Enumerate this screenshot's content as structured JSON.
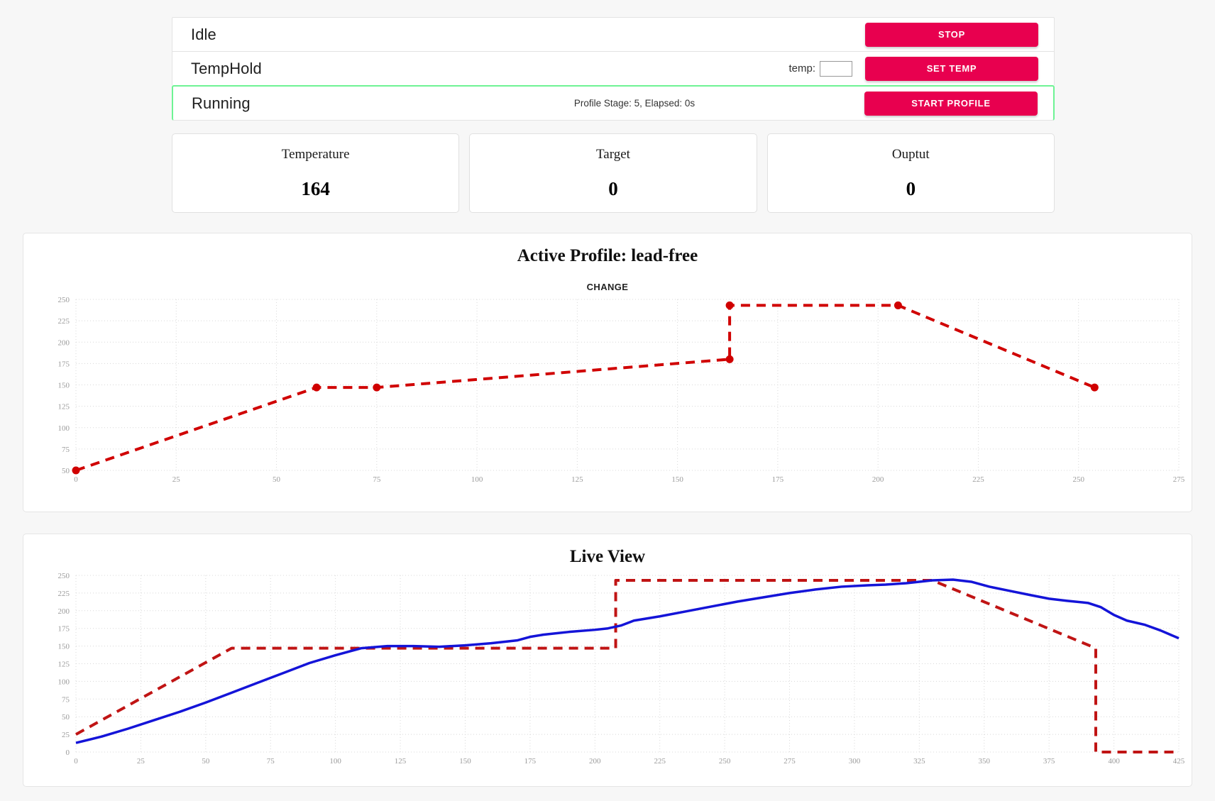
{
  "controls": {
    "rows": [
      {
        "label": "Idle",
        "middle": "",
        "button": "STOP"
      },
      {
        "label": "TempHold",
        "middle": "",
        "button": "SET TEMP",
        "temp_label": "temp:",
        "temp_value": "",
        "temp_placeholder": ""
      },
      {
        "label": "Running",
        "middle": "Profile Stage: 5, Elapsed: 0s",
        "button": "START PROFILE"
      }
    ],
    "active_row_index": 2,
    "accent_button_color": "#e8004f",
    "active_border_color": "#6ef394"
  },
  "cards": [
    {
      "title": "Temperature",
      "value": "164"
    },
    {
      "title": "Target",
      "value": "0"
    },
    {
      "title": "Ouptut",
      "value": "0"
    }
  ],
  "profile_panel": {
    "title": "Active Profile: lead-free",
    "sublabel": "CHANGE"
  },
  "live_panel": {
    "title": "Live View"
  },
  "chart_data": [
    {
      "id": "active-profile",
      "type": "line",
      "title": "Active Profile: lead-free",
      "subtitle": "CHANGE",
      "xlabel": "",
      "ylabel": "",
      "xlim": [
        0,
        275
      ],
      "ylim": [
        50,
        250
      ],
      "xticks": [
        0,
        25,
        50,
        75,
        100,
        125,
        150,
        175,
        200,
        225,
        250,
        275
      ],
      "yticks": [
        50,
        75,
        100,
        125,
        150,
        175,
        200,
        225,
        250
      ],
      "grid": true,
      "legend": "none",
      "series": [
        {
          "name": "profile",
          "color": "#d00000",
          "style": "dashed",
          "markers": true,
          "points": [
            [
              0,
              50
            ],
            [
              60,
              147
            ],
            [
              75,
              147
            ],
            [
              163,
              180
            ],
            [
              163,
              243
            ],
            [
              205,
              243
            ],
            [
              254,
              147
            ]
          ]
        }
      ]
    },
    {
      "id": "live-view",
      "type": "line",
      "title": "Live View",
      "xlabel": "",
      "ylabel": "",
      "xlim": [
        0,
        425
      ],
      "ylim": [
        0,
        250
      ],
      "xticks": [
        0,
        25,
        50,
        75,
        100,
        125,
        150,
        175,
        200,
        225,
        250,
        275,
        300,
        325,
        350,
        375,
        400,
        425
      ],
      "yticks": [
        0,
        25,
        50,
        75,
        100,
        125,
        150,
        175,
        200,
        225,
        250
      ],
      "grid": true,
      "legend": "none",
      "series": [
        {
          "name": "setpoint",
          "color": "#c01414",
          "style": "dashed",
          "markers": false,
          "points": [
            [
              0,
              25
            ],
            [
              60,
              147
            ],
            [
              208,
              147
            ],
            [
              208,
              243
            ],
            [
              330,
              243
            ],
            [
              393,
              147
            ],
            [
              393,
              0
            ],
            [
              425,
              0
            ]
          ]
        },
        {
          "name": "temperature",
          "color": "#1414d8",
          "style": "solid",
          "markers": false,
          "points": [
            [
              0,
              13
            ],
            [
              10,
              22
            ],
            [
              20,
              33
            ],
            [
              30,
              45
            ],
            [
              40,
              57
            ],
            [
              50,
              70
            ],
            [
              60,
              84
            ],
            [
              70,
              98
            ],
            [
              80,
              112
            ],
            [
              90,
              126
            ],
            [
              100,
              137
            ],
            [
              110,
              147
            ],
            [
              120,
              150
            ],
            [
              130,
              150
            ],
            [
              140,
              149
            ],
            [
              150,
              151
            ],
            [
              160,
              154
            ],
            [
              170,
              158
            ],
            [
              175,
              163
            ],
            [
              180,
              166
            ],
            [
              190,
              170
            ],
            [
              200,
              173
            ],
            [
              205,
              175
            ],
            [
              210,
              179
            ],
            [
              215,
              186
            ],
            [
              225,
              192
            ],
            [
              235,
              199
            ],
            [
              245,
              206
            ],
            [
              255,
              213
            ],
            [
              265,
              219
            ],
            [
              275,
              225
            ],
            [
              285,
              230
            ],
            [
              295,
              234
            ],
            [
              305,
              236
            ],
            [
              312,
              237
            ],
            [
              320,
              239
            ],
            [
              330,
              243
            ],
            [
              338,
              244
            ],
            [
              345,
              241
            ],
            [
              352,
              234
            ],
            [
              360,
              228
            ],
            [
              368,
              222
            ],
            [
              375,
              217
            ],
            [
              382,
              214
            ],
            [
              390,
              211
            ],
            [
              395,
              205
            ],
            [
              400,
              194
            ],
            [
              405,
              186
            ],
            [
              412,
              180
            ],
            [
              418,
              172
            ],
            [
              425,
              161
            ]
          ]
        }
      ]
    }
  ]
}
